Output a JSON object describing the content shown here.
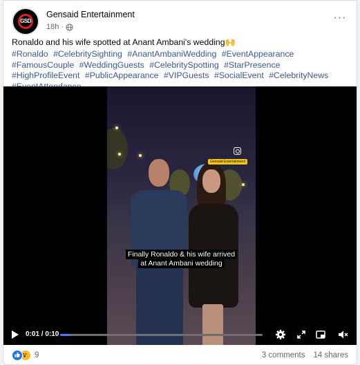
{
  "post": {
    "page_name": "Gensaid Entertainment",
    "timestamp": "18h",
    "avatar_text": "GSD",
    "caption": "Ronaldo and his wife spotted at Anant Ambani's wedding🙌",
    "hashtags": [
      "#Ronaldo",
      "#CelebritySighting",
      "#AnantAmbaniWedding",
      "#EventAppearance",
      "#FamousCouple",
      "#WeddingGuests",
      "#CelebritySpotting",
      "#StarPresence",
      "#HighProfileEvent",
      "#PublicAppearance",
      "#VIPGuests",
      "#SocialEvent",
      "#CelebrityNews",
      "#EventAttendance"
    ]
  },
  "video": {
    "overlay_tag": "Gensaid Entertainment",
    "subtitle_line1": "Finally Ronaldo & his wife arrived",
    "subtitle_line2": "at Anant Ambani wedding",
    "time": "0:01 / 0:10",
    "progress": 0.05,
    "icons": [
      "play-icon",
      "settings-icon",
      "expand-icon",
      "picture-in-picture-icon",
      "fullscreen-icon",
      "mute-icon"
    ]
  },
  "footer": {
    "reaction_count": "9",
    "comments": "3 comments",
    "shares": "14 shares"
  },
  "colors": {
    "hashtag": "#385898",
    "progress_fill": "#3b82f6",
    "like": "#1877f2",
    "wow": "#f7b928"
  }
}
